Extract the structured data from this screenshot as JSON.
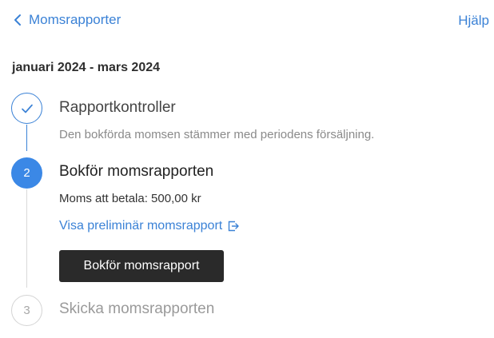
{
  "header": {
    "back_label": "Momsrapporter",
    "help_label": "Hjälp"
  },
  "period": "januari 2024 - mars 2024",
  "steps": [
    {
      "number": "1",
      "status": "done",
      "title": "Rapportkontroller",
      "description": "Den bokförda momsen stämmer med periodens försäljning."
    },
    {
      "number": "2",
      "status": "active",
      "title": "Bokför momsrapporten",
      "vat_line": "Moms att betala: 500,00 kr",
      "link_label": "Visa preliminär momsrapport",
      "button_label": "Bokför momsrapport"
    },
    {
      "number": "3",
      "status": "pending",
      "title": "Skicka momsrapporten"
    }
  ],
  "colors": {
    "accent": "#3b82d6",
    "active_step": "#3b88e6",
    "button_bg": "#2a2a2a",
    "muted": "#8a8a8a"
  },
  "icons": {
    "back": "chevron-left-icon",
    "done": "checkmark-icon",
    "external": "external-link-icon"
  }
}
